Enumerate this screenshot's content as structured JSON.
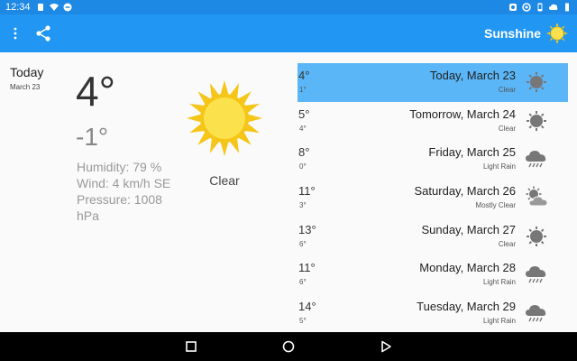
{
  "status_bar": {
    "time": "12:34"
  },
  "app_bar": {
    "title": "Sunshine"
  },
  "today": {
    "day": "Today",
    "date": "March 23",
    "high": "4°",
    "low": "-1°",
    "humidity": "Humidity: 79 %",
    "wind": "Wind: 4 km/h SE",
    "pressure": "Pressure: 1008 hPa",
    "description": "Clear",
    "icon": "sun-icon"
  },
  "forecast": [
    {
      "high": "4°",
      "low": "1°",
      "day": "Today, March 23",
      "condition": "Clear",
      "icon": "clear-icon"
    },
    {
      "high": "5°",
      "low": "4°",
      "day": "Tomorrow, March 24",
      "condition": "Clear",
      "icon": "clear-icon"
    },
    {
      "high": "8°",
      "low": "0°",
      "day": "Friday, March 25",
      "condition": "Light Rain",
      "icon": "light-rain-icon"
    },
    {
      "high": "11°",
      "low": "3°",
      "day": "Saturday, March 26",
      "condition": "Mostly Clear",
      "icon": "mostly-clear-icon"
    },
    {
      "high": "13°",
      "low": "6°",
      "day": "Sunday, March 27",
      "condition": "Clear",
      "icon": "clear-icon"
    },
    {
      "high": "11°",
      "low": "6°",
      "day": "Monday, March 28",
      "condition": "Light Rain",
      "icon": "light-rain-icon"
    },
    {
      "high": "14°",
      "low": "5°",
      "day": "Tuesday, March 29",
      "condition": "Light Rain",
      "icon": "light-rain-icon"
    }
  ],
  "colors": {
    "status_bar": "#1e88e5",
    "app_bar": "#2196f3",
    "selected_row": "#5ab6f7",
    "sun": "#fbe14b"
  }
}
